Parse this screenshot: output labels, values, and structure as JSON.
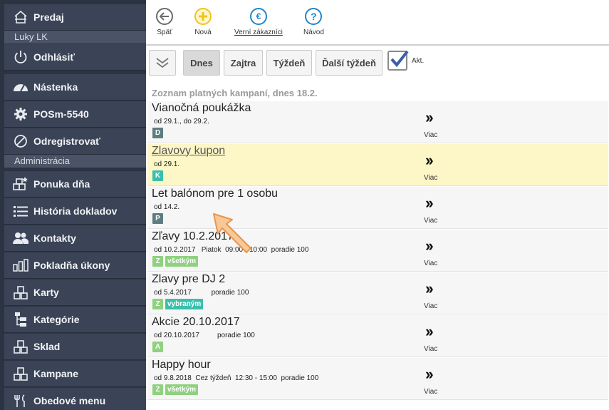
{
  "sidebar": {
    "items": [
      {
        "label": "Predaj",
        "icon": "home-icon"
      },
      {
        "label": "Odhlásiť",
        "icon": "power-icon"
      },
      {
        "label": "Nástenka",
        "icon": "dashboard-icon"
      },
      {
        "label": "POSm-5540",
        "icon": "gear-icon"
      },
      {
        "label": "Odregistrovať",
        "icon": "ban-icon"
      },
      {
        "label": "Ponuka dňa",
        "icon": "offer-icon"
      },
      {
        "label": "História dokladov",
        "icon": "list-icon"
      },
      {
        "label": "Kontakty",
        "icon": "users-icon"
      },
      {
        "label": "Pokladňa úkony",
        "icon": "bars-icon"
      },
      {
        "label": "Karty",
        "icon": "boxes-icon"
      },
      {
        "label": "Kategórie",
        "icon": "tree-icon"
      },
      {
        "label": "Sklad",
        "icon": "boxes-icon"
      },
      {
        "label": "Kampane",
        "icon": "boxes-icon"
      },
      {
        "label": "Obedové menu",
        "icon": "cutlery-icon"
      }
    ],
    "user": "Luky LK",
    "section_admin": "Administrácia"
  },
  "toolbar": {
    "back": "Späť",
    "new": "Nová",
    "loyal": "Verní zákazníci",
    "help": "Návod"
  },
  "filters": {
    "today": "Dnes",
    "tomorrow": "Zajtra",
    "week": "Týždeň",
    "next_week": "Ďalší týždeň",
    "active_label": "Akt."
  },
  "list_title": "Zoznam platných kampaní, dnes 18.2.",
  "more_label": "Viac",
  "colors": {
    "sidebar_bg": "#2c3444",
    "highlight": "#fdf6c6",
    "badge_gray": "#5e7d80",
    "badge_green": "#8fd17f",
    "badge_teal": "#3bbfad"
  },
  "campaigns": [
    {
      "name": "Vianočná poukážka",
      "details": "od 29.1., do 29.2.",
      "badges": [
        {
          "text": "D",
          "type": "gray"
        }
      ],
      "highlighted": false
    },
    {
      "name": "Zlavovy kupon",
      "details": "od 29.1.",
      "badges": [
        {
          "text": "K",
          "type": "teal"
        }
      ],
      "highlighted": true
    },
    {
      "name": "Let balónom pre 1 osobu",
      "details": "od 14.2.",
      "badges": [
        {
          "text": "P",
          "type": "gray"
        }
      ],
      "highlighted": false
    },
    {
      "name": "Zľavy 10.2.2017",
      "details": "od 10.2.2017   Piatok  09:00 - 10:00  poradie 100",
      "badges": [
        {
          "text": "Z",
          "type": "green"
        },
        {
          "text": "všetkým",
          "type": "green"
        }
      ],
      "highlighted": false
    },
    {
      "name": "Zlavy pre DJ 2",
      "details": "od 5.4.2017          poradie 100",
      "badges": [
        {
          "text": "Z",
          "type": "green"
        },
        {
          "text": "vybraným",
          "type": "teal"
        }
      ],
      "highlighted": false
    },
    {
      "name": "Akcie 20.10.2017",
      "details": "od 20.10.2017         poradie 100",
      "badges": [
        {
          "text": "A",
          "type": "green"
        }
      ],
      "highlighted": false
    },
    {
      "name": "Happy hour",
      "details": "od 9.8.2018  Cez týždeň  12:30 - 15:00  poradie 100",
      "badges": [
        {
          "text": "Z",
          "type": "green"
        },
        {
          "text": "všetkým",
          "type": "green"
        }
      ],
      "highlighted": false
    }
  ]
}
